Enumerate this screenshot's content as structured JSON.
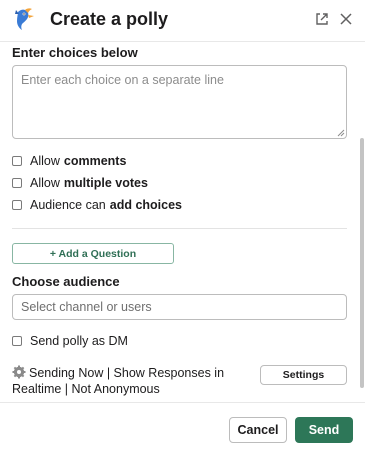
{
  "header": {
    "title": "Create a polly",
    "logo_icon": "polly-bird-logo",
    "external_icon": "open-external-icon",
    "close_icon": "close-icon"
  },
  "choices": {
    "label": "Enter choices below",
    "placeholder": "Enter each choice on a separate line",
    "value": ""
  },
  "options": [
    {
      "prefix": "Allow",
      "bold": "comments",
      "checked": false
    },
    {
      "prefix": "Allow",
      "bold": "multiple votes",
      "checked": false
    },
    {
      "prefix": "Audience can",
      "bold": "add choices",
      "checked": false
    }
  ],
  "add_question_label": "+ Add a Question",
  "audience": {
    "label": "Choose audience",
    "placeholder": "Select channel or users",
    "dm_label": "Send polly as DM",
    "dm_checked": false
  },
  "settings": {
    "summary": "Sending Now | Show Responses in Realtime | Not Anonymous",
    "button_label": "Settings",
    "icon": "gear-icon"
  },
  "footer": {
    "cancel_label": "Cancel",
    "send_label": "Send"
  },
  "colors": {
    "primary_green": "#2d7758",
    "add_question_border": "#88b6a3",
    "add_question_text": "#2f6f55",
    "logo_blue": "#3a7bd5",
    "logo_orange": "#f2a33a"
  }
}
